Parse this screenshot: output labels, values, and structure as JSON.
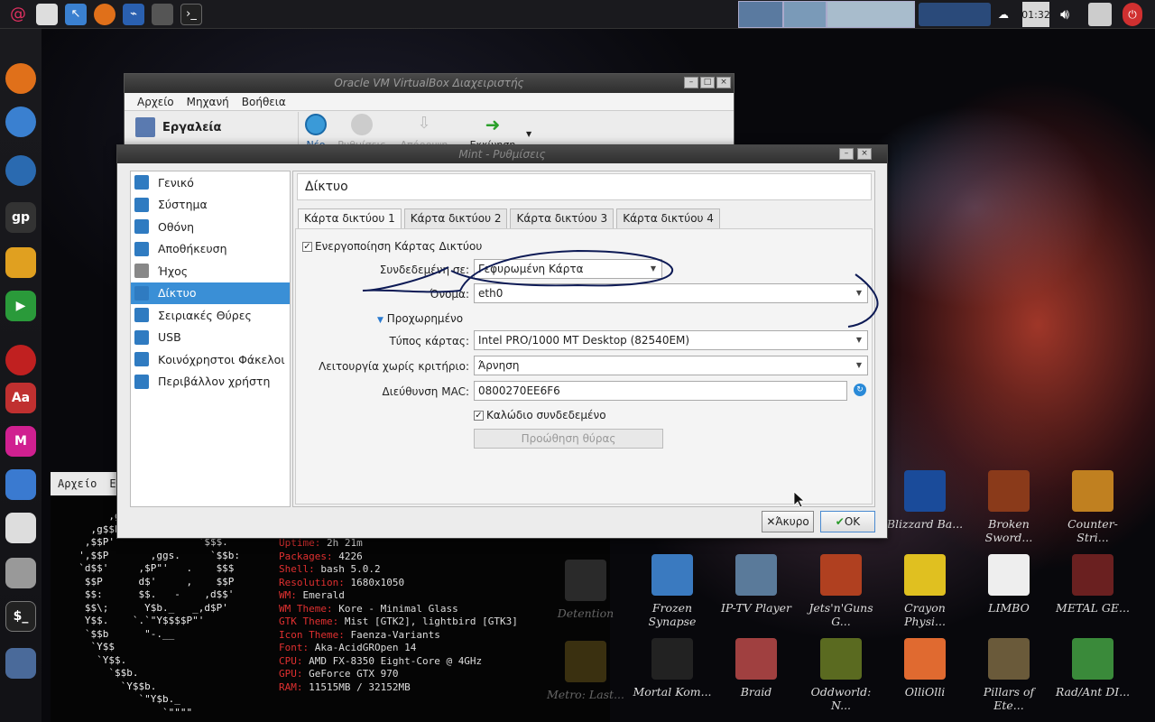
{
  "top_panel": {
    "clock": "01:32",
    "launchers": [
      "debian-icon",
      "home-folder-icon",
      "pointer-icon",
      "firefox-icon",
      "system-monitor-icon",
      "cube-icon",
      "terminal-icon"
    ]
  },
  "manager": {
    "title": "Oracle VM VirtualBox Διαχειριστής",
    "menu": [
      "Αρχείο",
      "Μηχανή",
      "Βοήθεια"
    ],
    "tools_label": "Εργαλεία",
    "toolbar": [
      "Νέο",
      "Ρυθμίσεις",
      "Απόρριψη",
      "Εκκίνηση"
    ]
  },
  "dialog": {
    "title": "Mint - Ρυθμίσεις",
    "categories": [
      "Γενικό",
      "Σύστημα",
      "Οθόνη",
      "Αποθήκευση",
      "Ήχος",
      "Δίκτυο",
      "Σειριακές Θύρες",
      "USB",
      "Κοινόχρηστοι Φάκελοι",
      "Περιβάλλον χρήστη"
    ],
    "section_title": "Δίκτυο",
    "tabs": [
      "Κάρτα δικτύου 1",
      "Κάρτα δικτύου 2",
      "Κάρτα δικτύου 3",
      "Κάρτα δικτύου 4"
    ],
    "enable_label": "Ενεργοποίηση Κάρτας Δικτύου",
    "attached_label": "Συνδεδεμένη σε:",
    "attached_value": "Γεφυρωμένη Κάρτα",
    "name_label": "Όνομα:",
    "name_value": "eth0",
    "advanced_label": "Προχωρημένο",
    "adapter_type_label": "Τύπος κάρτας:",
    "adapter_type_value": "Intel PRO/1000 MT Desktop (82540EM)",
    "promisc_label": "Λειτουργία χωρίς κριτήριο:",
    "promisc_value": "Άρνηση",
    "mac_label": "Διεύθυνση MAC:",
    "mac_value": "0800270EE6F6",
    "cable_label": "Καλώδιο συνδεδεμένο",
    "port_forward_label": "Προώθηση θύρας",
    "cancel_label": "Άκυρο",
    "ok_label": "OK"
  },
  "terminal": {
    "menu": [
      "Αρχείο",
      "Επ"
    ],
    "ascii": [
      "       ,g$$$$$$$$$gg.",
      "    ,g$$P\"\"       \"\"\"Y$$.\".",
      "   ,$$P'              `$$$.",
      "  ',$$P       ,ggs.     `$$b:",
      "  `d$$'     ,$P\"'   .    $$$",
      "   $$P      d$'     ,    $$P",
      "   $$:      $$.   -    ,d$$'",
      "   $$\\;      Y$b._   _,d$P'",
      "   Y$$.    `.`\"Y$$$$P\"'",
      "   `$$b      \"-.__",
      "    `Y$$",
      "     `Y$$.",
      "       `$$b.",
      "         `Y$$b.",
      "            `\"Y$b._",
      "                `\"\"\"\""
    ],
    "info": [
      {
        "k": "Uptime:",
        "v": "2h 21m"
      },
      {
        "k": "Packages:",
        "v": "4226"
      },
      {
        "k": "Shell:",
        "v": "bash 5.0.2"
      },
      {
        "k": "Resolution:",
        "v": "1680x1050"
      },
      {
        "k": "WM:",
        "v": "Emerald"
      },
      {
        "k": "WM Theme:",
        "v": "Kore - Minimal Glass"
      },
      {
        "k": "GTK Theme:",
        "v": "Mist [GTK2], lightbird [GTK3]"
      },
      {
        "k": "Icon Theme:",
        "v": "Faenza-Variants"
      },
      {
        "k": "Font:",
        "v": "Aka-AcidGROpen 14"
      },
      {
        "k": "CPU:",
        "v": "AMD FX-8350 Eight-Core @ 4GHz"
      },
      {
        "k": "GPU:",
        "v": "GeForce GTX 970"
      },
      {
        "k": "RAM:",
        "v": "11515MB / 32152MB"
      }
    ]
  },
  "desktop_icons": [
    {
      "label": "Blizzard Ba...",
      "color": "#1a4b9a"
    },
    {
      "label": "Broken Sword...",
      "color": "#8a3a1a"
    },
    {
      "label": "Counter-Stri...",
      "color": "#c08020"
    },
    {
      "label": "Frozen Synapse",
      "color": "#3a7ac0"
    },
    {
      "label": "IP-TV Player",
      "color": "#5a7a9a"
    },
    {
      "label": "Jets'n'Guns G...",
      "color": "#b04020"
    },
    {
      "label": "Crayon Physi...",
      "color": "#e0c020"
    },
    {
      "label": "LIMBO",
      "color": "#eeeeee"
    },
    {
      "label": "METAL GE...",
      "color": "#6a2020"
    },
    {
      "label": "Mortal Kom...",
      "color": "#222222"
    },
    {
      "label": "Braid",
      "color": "#a04040"
    },
    {
      "label": "Oddworld: N...",
      "color": "#5a6a20"
    },
    {
      "label": "OlliOlli",
      "color": "#e06a30"
    },
    {
      "label": "Pillars of Ete...",
      "color": "#6a5a3a"
    },
    {
      "label": "Rad/Ant DI...",
      "color": "#3a8a3a"
    }
  ],
  "dim_icons": [
    "Detention",
    "Metro: Last..."
  ]
}
